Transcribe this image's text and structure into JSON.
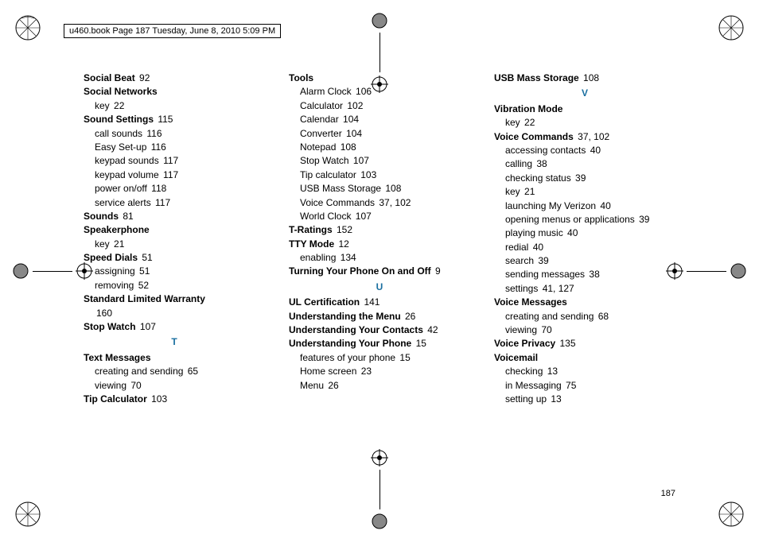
{
  "header": "u460.book  Page 187  Tuesday, June 8, 2010  5:09 PM",
  "page_number": "187",
  "columns": [
    [
      {
        "type": "main",
        "text": "Social Beat",
        "page": "92"
      },
      {
        "type": "main",
        "text": "Social Networks"
      },
      {
        "type": "sub",
        "text": "key",
        "page": "22"
      },
      {
        "type": "main",
        "text": "Sound Settings",
        "page": "115"
      },
      {
        "type": "sub",
        "text": "call sounds",
        "page": "116"
      },
      {
        "type": "sub",
        "text": "Easy Set-up",
        "page": "116"
      },
      {
        "type": "sub",
        "text": "keypad sounds",
        "page": "117"
      },
      {
        "type": "sub",
        "text": "keypad volume",
        "page": "117"
      },
      {
        "type": "sub",
        "text": "power on/off",
        "page": "118"
      },
      {
        "type": "sub",
        "text": "service alerts",
        "page": "117"
      },
      {
        "type": "main",
        "text": "Sounds",
        "page": "81"
      },
      {
        "type": "main",
        "text": "Speakerphone"
      },
      {
        "type": "sub",
        "text": "key",
        "page": "21"
      },
      {
        "type": "main",
        "text": "Speed Dials",
        "page": "51"
      },
      {
        "type": "sub",
        "text": "assigning",
        "page": "51"
      },
      {
        "type": "sub",
        "text": "removing",
        "page": "52"
      },
      {
        "type": "main",
        "text": "Standard Limited Warranty"
      },
      {
        "type": "sub",
        "text": "",
        "page": "160"
      },
      {
        "type": "main",
        "text": "Stop Watch",
        "page": "107"
      },
      {
        "type": "letter",
        "text": "T"
      },
      {
        "type": "main",
        "text": "Text Messages"
      },
      {
        "type": "sub",
        "text": "creating and sending",
        "page": "65"
      },
      {
        "type": "sub",
        "text": "viewing",
        "page": "70"
      },
      {
        "type": "main",
        "text": "Tip Calculator",
        "page": "103"
      }
    ],
    [
      {
        "type": "main",
        "text": "Tools"
      },
      {
        "type": "sub",
        "text": "Alarm Clock",
        "page": "106"
      },
      {
        "type": "sub",
        "text": "Calculator",
        "page": "102"
      },
      {
        "type": "sub",
        "text": "Calendar",
        "page": "104"
      },
      {
        "type": "sub",
        "text": "Converter",
        "page": "104"
      },
      {
        "type": "sub",
        "text": "Notepad",
        "page": "108"
      },
      {
        "type": "sub",
        "text": "Stop Watch",
        "page": "107"
      },
      {
        "type": "sub",
        "text": "Tip calculator",
        "page": "103"
      },
      {
        "type": "sub",
        "text": "USB Mass Storage",
        "page": "108"
      },
      {
        "type": "sub",
        "text": "Voice Commands",
        "page": "37, 102"
      },
      {
        "type": "sub",
        "text": "World Clock",
        "page": "107"
      },
      {
        "type": "main",
        "text": "T-Ratings",
        "page": "152"
      },
      {
        "type": "main",
        "text": "TTY Mode",
        "page": "12"
      },
      {
        "type": "sub",
        "text": "enabling",
        "page": "134"
      },
      {
        "type": "main",
        "text": "Turning Your Phone On and Off",
        "page": "9"
      },
      {
        "type": "letter",
        "text": "U"
      },
      {
        "type": "main",
        "text": "UL Certification",
        "page": "141"
      },
      {
        "type": "main",
        "text": "Understanding the Menu",
        "page": "26"
      },
      {
        "type": "main",
        "text": "Understanding Your Contacts",
        "page": "42"
      },
      {
        "type": "main",
        "text": "Understanding Your Phone",
        "page": "15"
      },
      {
        "type": "sub",
        "text": "features of your phone",
        "page": "15"
      },
      {
        "type": "sub",
        "text": "Home screen",
        "page": "23"
      },
      {
        "type": "sub",
        "text": "Menu",
        "page": "26"
      }
    ],
    [
      {
        "type": "main",
        "text": "USB Mass Storage",
        "page": "108"
      },
      {
        "type": "letter",
        "text": "V"
      },
      {
        "type": "main",
        "text": "Vibration Mode"
      },
      {
        "type": "sub",
        "text": "key",
        "page": "22"
      },
      {
        "type": "main",
        "text": "Voice Commands",
        "page": "37, 102"
      },
      {
        "type": "sub",
        "text": "accessing contacts",
        "page": "40"
      },
      {
        "type": "sub",
        "text": "calling",
        "page": "38"
      },
      {
        "type": "sub",
        "text": "checking status",
        "page": "39"
      },
      {
        "type": "sub",
        "text": "key",
        "page": "21"
      },
      {
        "type": "sub",
        "text": "launching My Verizon",
        "page": "40"
      },
      {
        "type": "sub",
        "text": "opening menus or applications",
        "page": "39"
      },
      {
        "type": "sub",
        "text": "playing music",
        "page": "40"
      },
      {
        "type": "sub",
        "text": "redial",
        "page": "40"
      },
      {
        "type": "sub",
        "text": "search",
        "page": "39"
      },
      {
        "type": "sub",
        "text": "sending messages",
        "page": "38"
      },
      {
        "type": "sub",
        "text": "settings",
        "page": "41, 127"
      },
      {
        "type": "main",
        "text": "Voice Messages"
      },
      {
        "type": "sub",
        "text": "creating and sending",
        "page": "68"
      },
      {
        "type": "sub",
        "text": "viewing",
        "page": "70"
      },
      {
        "type": "main",
        "text": "Voice Privacy",
        "page": "135"
      },
      {
        "type": "main",
        "text": "Voicemail"
      },
      {
        "type": "sub",
        "text": "checking",
        "page": "13"
      },
      {
        "type": "sub",
        "text": "in Messaging",
        "page": "75"
      },
      {
        "type": "sub",
        "text": "setting up",
        "page": "13"
      }
    ]
  ]
}
